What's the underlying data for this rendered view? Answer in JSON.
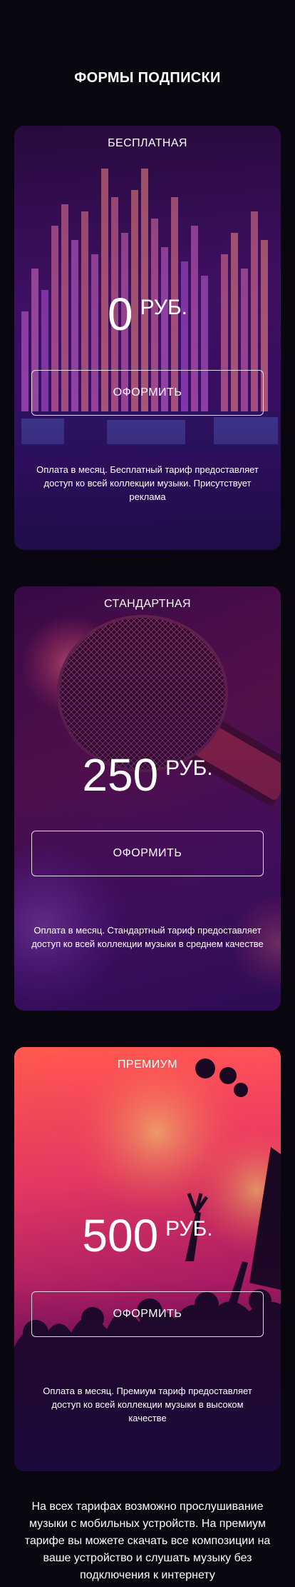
{
  "page": {
    "title": "ФОРМЫ ПОДПИСКИ",
    "footer": "На всех тарифах возможно прослушивание музыки с мобильных устройств. На премиум тарифе вы можете скачать все композиции на ваше устройство и слушать музыку без подключения к интернету"
  },
  "plans": [
    {
      "name": "БЕСПЛАТНАЯ",
      "price": "0",
      "currency": "РУБ.",
      "button": "ОФОРМИТЬ",
      "description": "Оплата в месяц. Бесплатный тариф предоставляет доступ ко всей коллекции музыки. Присутствует реклама",
      "image": "audio-mixer-tracks"
    },
    {
      "name": "СТАНДАРТНАЯ",
      "price": "250",
      "currency": "РУБ.",
      "button": "ОФОРМИТЬ",
      "description": "Оплата в месяц. Стандартный тариф предоставляет доступ ко всей коллекции музыки в среднем качестве",
      "image": "microphone"
    },
    {
      "name": "ПРЕМИУМ",
      "price": "500",
      "currency": "РУБ.",
      "button": "ОФОРМИТЬ",
      "description": "Оплата в месяц. Премиум тариф предоставляет доступ ко всей коллекции музыки в высоком качестве",
      "image": "concert-crowd"
    }
  ],
  "colors": {
    "background": "#0a0610",
    "text": "#ffffff"
  }
}
